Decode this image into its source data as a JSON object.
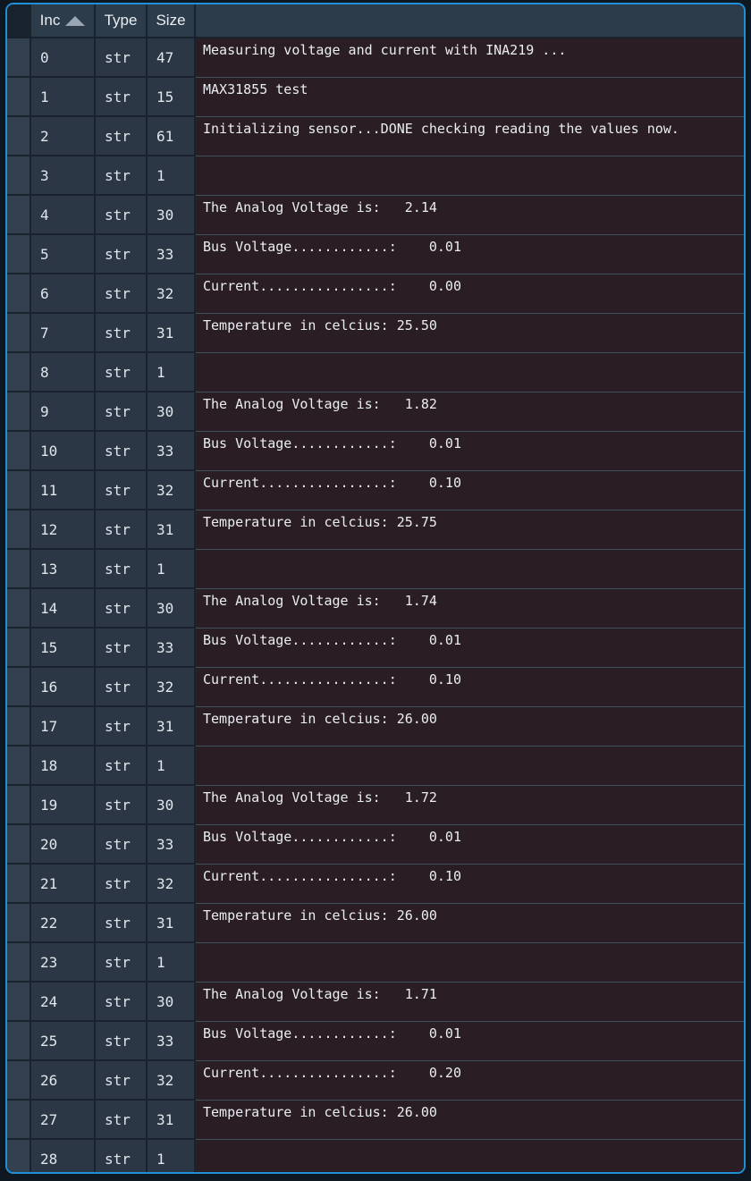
{
  "panel": {
    "name": "variable-explorer",
    "border_color": "#1f8fd6",
    "background": "#19232d"
  },
  "table": {
    "columns": [
      {
        "key": "index",
        "label": "Inc",
        "sorted": true,
        "sort_dir": "asc",
        "sort_icon": "caret-up-icon"
      },
      {
        "key": "type",
        "label": "Type"
      },
      {
        "key": "size",
        "label": "Size"
      },
      {
        "key": "value",
        "label": ""
      }
    ],
    "rows": [
      {
        "index": "0",
        "type": "str",
        "size": "47",
        "value": "Measuring voltage and current with INA219 ..."
      },
      {
        "index": "1",
        "type": "str",
        "size": "15",
        "value": "MAX31855 test"
      },
      {
        "index": "2",
        "type": "str",
        "size": "61",
        "value": "Initializing sensor...DONE checking reading the values now."
      },
      {
        "index": "3",
        "type": "str",
        "size": "1",
        "value": ""
      },
      {
        "index": "4",
        "type": "str",
        "size": "30",
        "value": "The Analog Voltage is:   2.14"
      },
      {
        "index": "5",
        "type": "str",
        "size": "33",
        "value": "Bus Voltage............:    0.01"
      },
      {
        "index": "6",
        "type": "str",
        "size": "32",
        "value": "Current................:    0.00"
      },
      {
        "index": "7",
        "type": "str",
        "size": "31",
        "value": "Temperature in celcius: 25.50"
      },
      {
        "index": "8",
        "type": "str",
        "size": "1",
        "value": ""
      },
      {
        "index": "9",
        "type": "str",
        "size": "30",
        "value": "The Analog Voltage is:   1.82"
      },
      {
        "index": "10",
        "type": "str",
        "size": "33",
        "value": "Bus Voltage............:    0.01"
      },
      {
        "index": "11",
        "type": "str",
        "size": "32",
        "value": "Current................:    0.10"
      },
      {
        "index": "12",
        "type": "str",
        "size": "31",
        "value": "Temperature in celcius: 25.75"
      },
      {
        "index": "13",
        "type": "str",
        "size": "1",
        "value": ""
      },
      {
        "index": "14",
        "type": "str",
        "size": "30",
        "value": "The Analog Voltage is:   1.74"
      },
      {
        "index": "15",
        "type": "str",
        "size": "33",
        "value": "Bus Voltage............:    0.01"
      },
      {
        "index": "16",
        "type": "str",
        "size": "32",
        "value": "Current................:    0.10"
      },
      {
        "index": "17",
        "type": "str",
        "size": "31",
        "value": "Temperature in celcius: 26.00"
      },
      {
        "index": "18",
        "type": "str",
        "size": "1",
        "value": ""
      },
      {
        "index": "19",
        "type": "str",
        "size": "30",
        "value": "The Analog Voltage is:   1.72"
      },
      {
        "index": "20",
        "type": "str",
        "size": "33",
        "value": "Bus Voltage............:    0.01"
      },
      {
        "index": "21",
        "type": "str",
        "size": "32",
        "value": "Current................:    0.10"
      },
      {
        "index": "22",
        "type": "str",
        "size": "31",
        "value": "Temperature in celcius: 26.00"
      },
      {
        "index": "23",
        "type": "str",
        "size": "1",
        "value": ""
      },
      {
        "index": "24",
        "type": "str",
        "size": "30",
        "value": "The Analog Voltage is:   1.71"
      },
      {
        "index": "25",
        "type": "str",
        "size": "33",
        "value": "Bus Voltage............:    0.01"
      },
      {
        "index": "26",
        "type": "str",
        "size": "32",
        "value": "Current................:    0.20"
      },
      {
        "index": "27",
        "type": "str",
        "size": "31",
        "value": "Temperature in celcius: 26.00"
      },
      {
        "index": "28",
        "type": "str",
        "size": "1",
        "value": ""
      }
    ]
  },
  "colors": {
    "accent_border": "#1f8fd6",
    "header_bg": "#2d3c4b",
    "meta_cell_bg": "#2b3744",
    "gutter_bg": "#32404f",
    "value_cell_bg": "#2a1d23",
    "text": "#e9eef3",
    "row_separator": "#3d5260"
  }
}
